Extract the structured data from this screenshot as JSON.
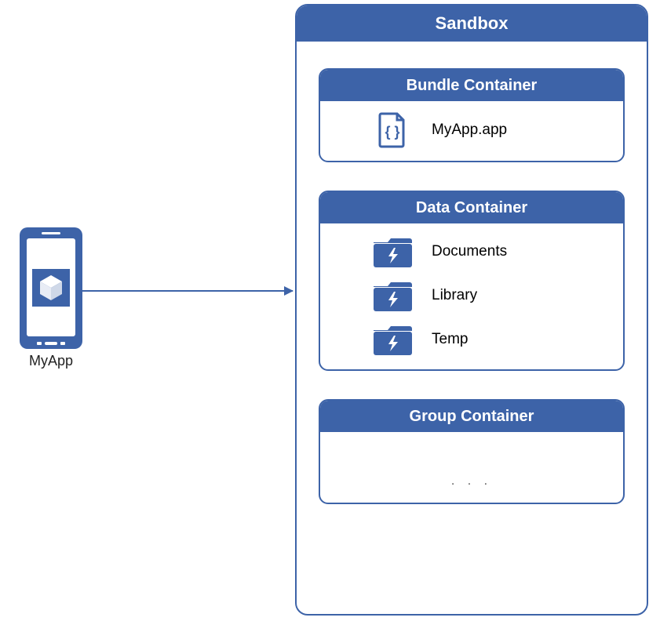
{
  "app": {
    "label": "MyApp"
  },
  "sandbox": {
    "title": "Sandbox",
    "bundle": {
      "title": "Bundle Container",
      "item": "MyApp.app"
    },
    "data": {
      "title": "Data Container",
      "items": [
        "Documents",
        "Library",
        "Temp"
      ]
    },
    "group": {
      "title": "Group Container",
      "placeholder": ". . ."
    }
  },
  "colors": {
    "primary": "#3d63a8"
  }
}
